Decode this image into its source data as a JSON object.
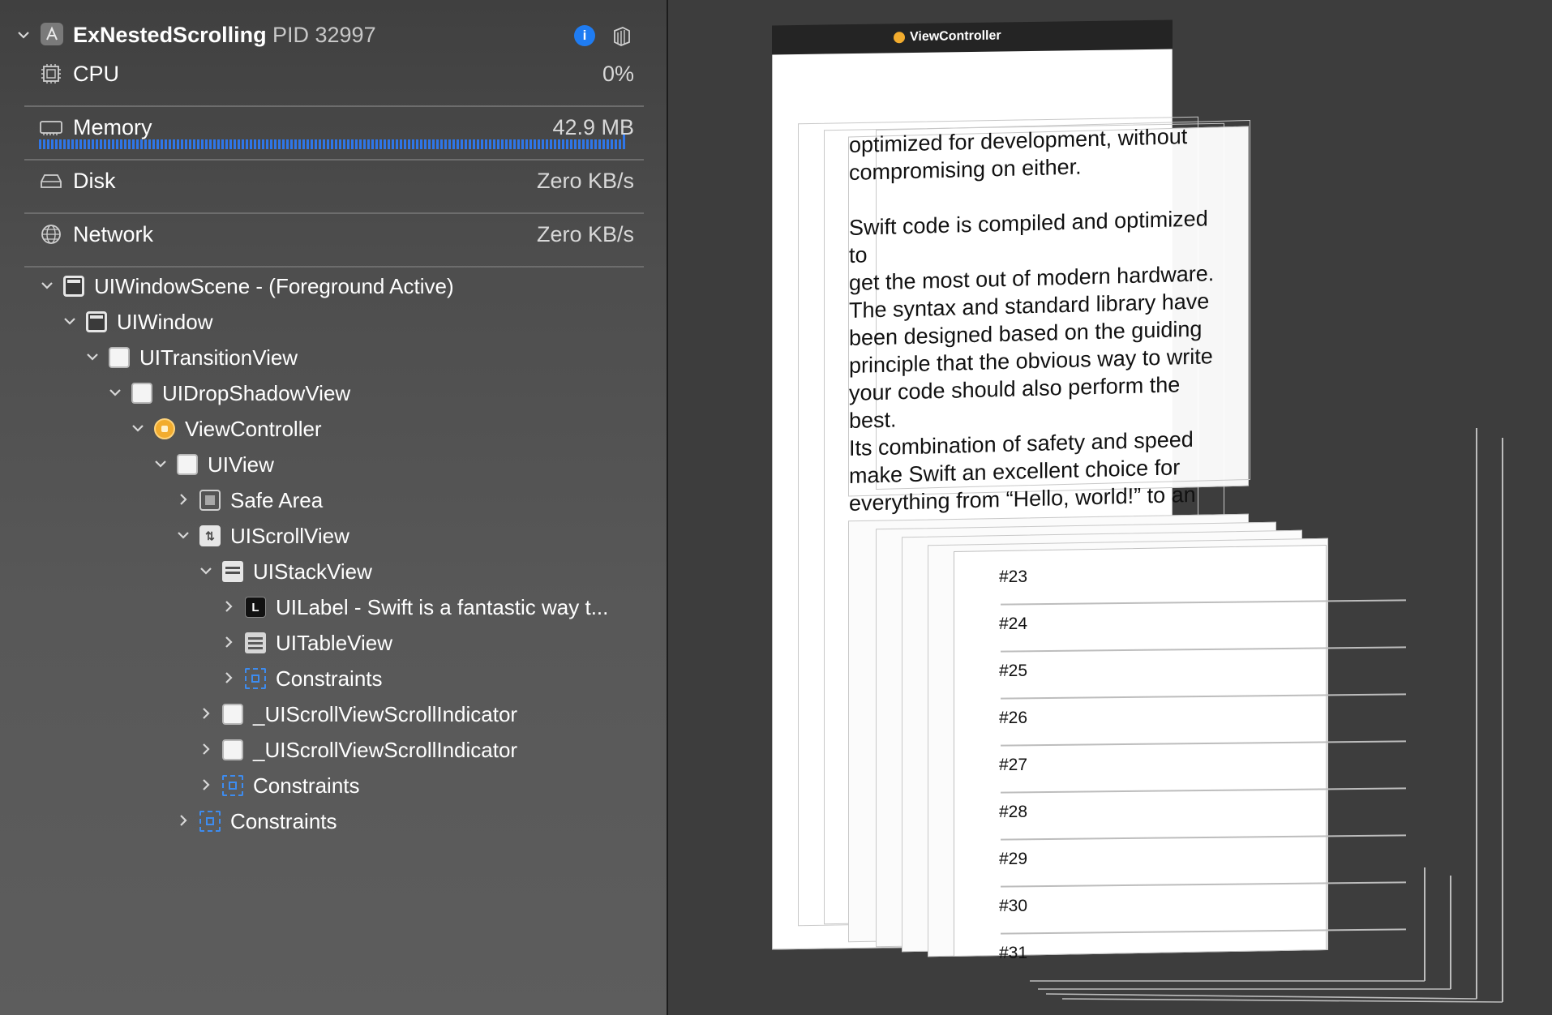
{
  "process": {
    "name": "ExNestedScrolling",
    "pid": "PID 32997",
    "app_icon": "xcode-app-icon",
    "info_icon": "info-icon",
    "share_icon": "share-icon"
  },
  "metrics": [
    {
      "key": "cpu",
      "label": "CPU",
      "value": "0%",
      "icon": "cpu-icon"
    },
    {
      "key": "memory",
      "label": "Memory",
      "value": "42.9 MB",
      "icon": "memory-icon",
      "usage_fraction": 0.93
    },
    {
      "key": "disk",
      "label": "Disk",
      "value": "Zero KB/s",
      "icon": "disk-icon"
    },
    {
      "key": "network",
      "label": "Network",
      "value": "Zero KB/s",
      "icon": "network-icon"
    }
  ],
  "tree": [
    {
      "label": "UIWindowScene - (Foreground Active)",
      "icon": "window-scene-icon",
      "expanded": true,
      "depth": 0
    },
    {
      "label": "UIWindow",
      "icon": "window-icon",
      "expanded": true,
      "depth": 1
    },
    {
      "label": "UITransitionView",
      "icon": "view-icon",
      "expanded": true,
      "depth": 2
    },
    {
      "label": "UIDropShadowView",
      "icon": "view-icon",
      "expanded": true,
      "depth": 3
    },
    {
      "label": "ViewController",
      "icon": "view-controller-icon",
      "expanded": true,
      "depth": 4
    },
    {
      "label": "UIView",
      "icon": "view-icon",
      "expanded": true,
      "depth": 5
    },
    {
      "label": "Safe Area",
      "icon": "safe-area-icon",
      "expanded": false,
      "depth": 6
    },
    {
      "label": "UIScrollView",
      "icon": "scroll-view-icon",
      "expanded": true,
      "depth": 6
    },
    {
      "label": "UIStackView",
      "icon": "stack-view-icon",
      "expanded": true,
      "depth": 7
    },
    {
      "label": "UILabel - Swift is a fantastic way t...",
      "icon": "label-icon",
      "expanded": false,
      "depth": 8
    },
    {
      "label": "UITableView",
      "icon": "table-view-icon",
      "expanded": false,
      "depth": 8
    },
    {
      "label": "Constraints",
      "icon": "constraints-icon",
      "expanded": false,
      "depth": 8
    },
    {
      "label": "_UIScrollViewScrollIndicator",
      "icon": "view-icon",
      "expanded": false,
      "depth": 7
    },
    {
      "label": "_UIScrollViewScrollIndicator",
      "icon": "view-icon",
      "expanded": false,
      "depth": 7
    },
    {
      "label": "Constraints",
      "icon": "constraints-icon",
      "expanded": false,
      "depth": 7
    },
    {
      "label": "Constraints",
      "icon": "constraints-icon",
      "expanded": false,
      "depth": 6
    }
  ],
  "canvas": {
    "vc_title": "ViewController",
    "label_text": "optimized for development, without\ncompromising on either.\n\nSwift code is compiled and optimized to\nget the most out of modern hardware.\nThe syntax and standard library have\nbeen designed based on the guiding\nprinciple that the obvious way to write\nyour code should also perform the best.\nIts combination of safety and speed\nmake Swift an excellent choice for\neverything from “Hello, world!” to an\nentire operating system.",
    "rows": [
      "#23",
      "#24",
      "#25",
      "#26",
      "#27",
      "#28",
      "#29",
      "#30",
      "#31"
    ]
  },
  "colors": {
    "accent": "#2f76e8",
    "info_button": "#1f7cf2",
    "constraints": "#3d8cf0",
    "view_controller": "#f2ac2e"
  }
}
